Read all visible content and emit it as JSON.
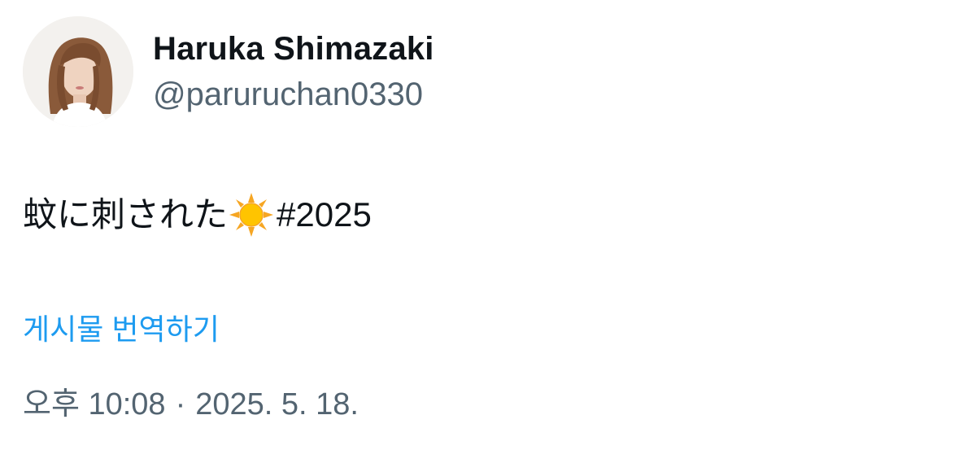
{
  "user": {
    "display_name": "Haruka Shimazaki",
    "handle": "@paruruchan0330",
    "avatar_icon": "profile-photo"
  },
  "tweet": {
    "text": "蚊に刺された",
    "emoji": "sun-emoji",
    "hashtag": "#2025",
    "translate_label": "게시물 번역하기",
    "time": "오후 10:08",
    "separator": "·",
    "date": "2025. 5. 18."
  },
  "colors": {
    "link": "#1d9bf0",
    "secondary_text": "#536471",
    "primary_text": "#0f1419"
  }
}
